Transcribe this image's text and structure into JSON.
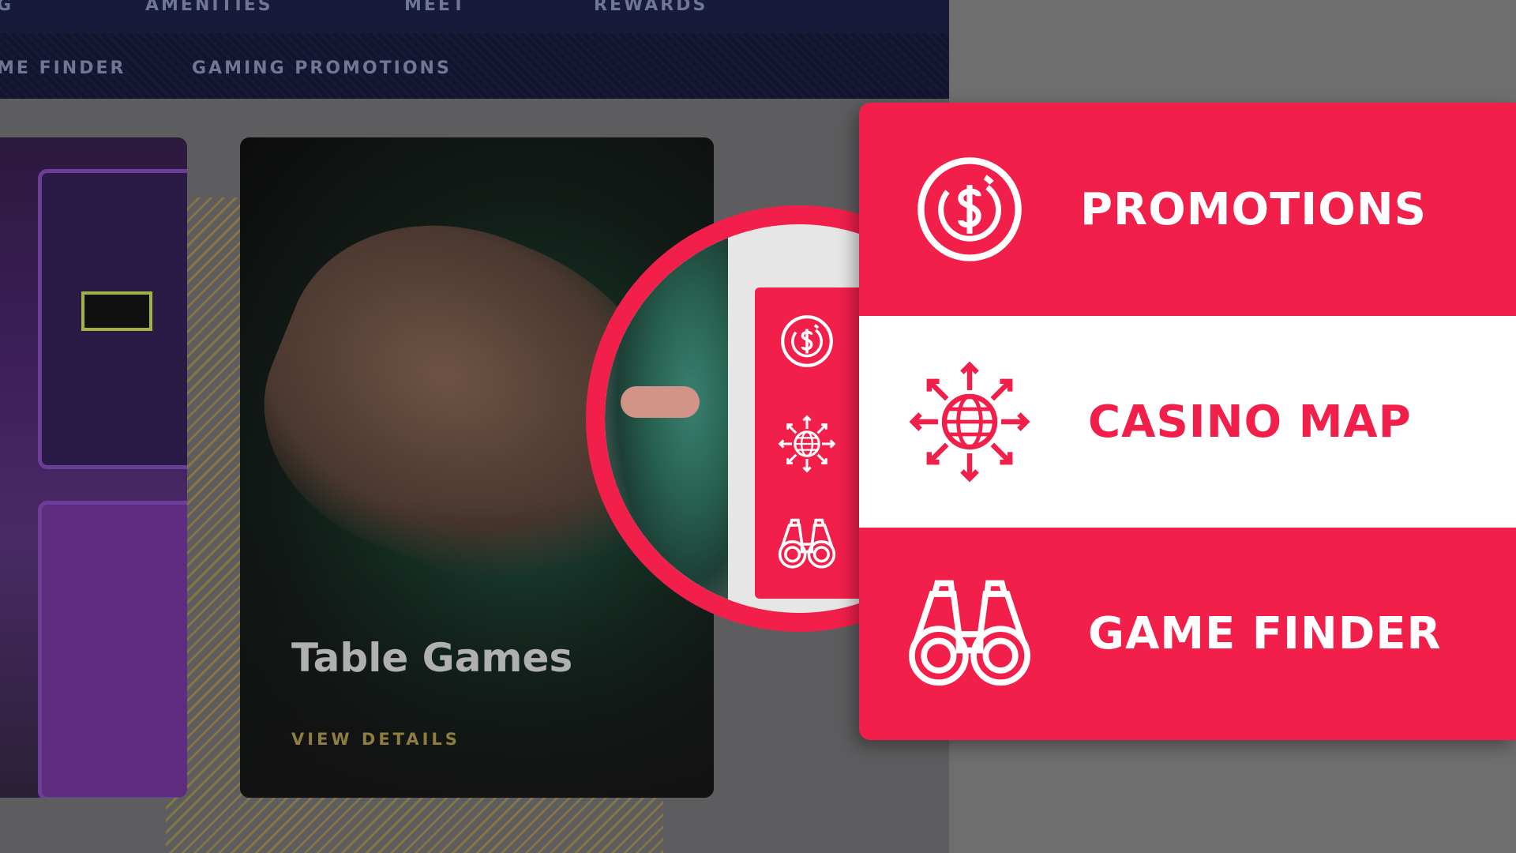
{
  "colors": {
    "accent": "#f21f4b",
    "nav_bg": "#171a38",
    "gold": "#8e7d3c"
  },
  "topnav": {
    "items": [
      "G",
      "AMENITIES",
      "MEET",
      "REWARDS"
    ]
  },
  "subnav": {
    "items": [
      "ME FINDER",
      "GAMING PROMOTIONS"
    ]
  },
  "card": {
    "title": "Table Games",
    "link": "VIEW DETAILS"
  },
  "mini_menu": {
    "icons": [
      "dollar-coin-icon",
      "globe-arrows-icon",
      "binoculars-icon"
    ]
  },
  "menu": {
    "items": [
      {
        "label": "PROMOTIONS",
        "icon": "dollar-coin-icon"
      },
      {
        "label": "CASINO MAP",
        "icon": "globe-arrows-icon"
      },
      {
        "label": "GAME FINDER",
        "icon": "binoculars-icon"
      }
    ]
  }
}
